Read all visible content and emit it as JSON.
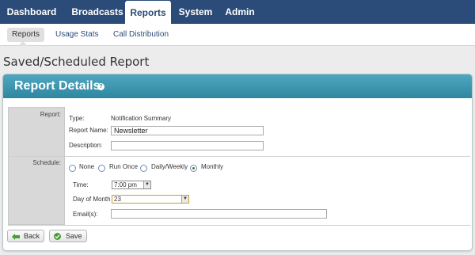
{
  "topnav": {
    "tabs": [
      {
        "label": "Dashboard"
      },
      {
        "label": "Broadcasts"
      },
      {
        "label": "Reports",
        "active": true
      },
      {
        "label": "System"
      },
      {
        "label": "Admin"
      }
    ]
  },
  "subnav": {
    "items": [
      {
        "label": "Reports",
        "active": true
      },
      {
        "label": "Usage Stats"
      },
      {
        "label": "Call Distribution"
      }
    ]
  },
  "page": {
    "title": "Saved/Scheduled Report"
  },
  "panel": {
    "title": "Report Details",
    "help_icon": "help-icon"
  },
  "report_section": {
    "label": "Report:",
    "type_label": "Type:",
    "type_value": "Notification Summary",
    "name_label": "Report Name:",
    "name_value": "Newsletter",
    "description_label": "Description:",
    "description_value": ""
  },
  "schedule_section": {
    "label": "Schedule:",
    "options": [
      {
        "label": "None",
        "checked": false
      },
      {
        "label": "Run Once",
        "checked": false
      },
      {
        "label": "Daily/Weekly",
        "checked": false
      },
      {
        "label": "Monthly",
        "checked": true
      }
    ],
    "time_label": "Time:",
    "time_value": "7:00 pm",
    "day_label": "Day of Month",
    "day_value": "23",
    "emails_label": "Email(s):",
    "emails_value": ""
  },
  "buttons": {
    "back": "Back",
    "save": "Save"
  },
  "colors": {
    "nav": "#2b4c78",
    "panel_header": "#2f86a0",
    "link": "#2b4c78"
  }
}
